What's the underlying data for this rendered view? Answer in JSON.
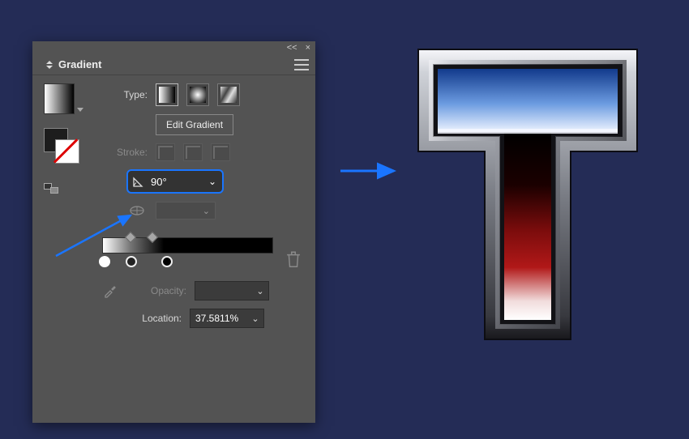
{
  "panel": {
    "title": "Gradient",
    "collapse_label": "<<",
    "close_label": "×",
    "type_label": "Type:",
    "type_options": [
      "linear",
      "radial",
      "freeform"
    ],
    "type_selected": "linear",
    "edit_button": "Edit Gradient",
    "stroke_label": "Stroke:",
    "angle_label": "Angle",
    "angle_value": "90°",
    "aspect_ratio_label": "Aspect Ratio",
    "opacity_label": "Opacity:",
    "opacity_value": "",
    "location_label": "Location:",
    "location_value": "37.5811%",
    "gradient_stops": [
      {
        "color": "#ffffff",
        "position": 0
      },
      {
        "color": "#222222",
        "position": 16.6
      },
      {
        "color": "#000000",
        "position": 37.5811
      }
    ],
    "opacity_stops": [
      {
        "position": 14
      },
      {
        "position": 27
      }
    ],
    "icons": {
      "trash": "trash-icon",
      "eyedropper": "eyedropper-icon",
      "menu": "menu-icon"
    }
  },
  "annotations": {
    "highlight_color": "#1a75ff",
    "arrow_color": "#1a75ff"
  },
  "preview": {
    "letter": "T",
    "outline_light": "#f5f5f5",
    "outline_dark": "#2b2b30",
    "top_gradient": [
      "#163a8c",
      "#6b9be0",
      "#e8f0ff"
    ],
    "stem_gradient": [
      "#000000",
      "#2b0000",
      "#7a0c0c",
      "#b21818",
      "#f3e0e0",
      "#ffffff"
    ]
  }
}
